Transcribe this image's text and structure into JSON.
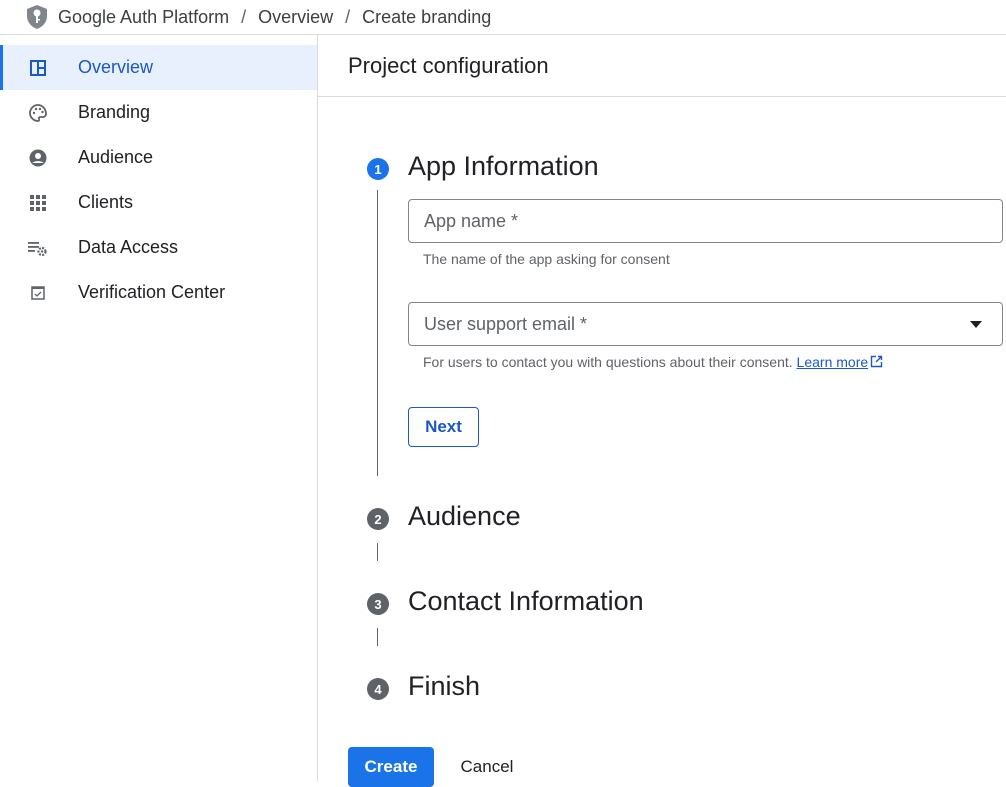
{
  "breadcrumb": [
    "Google Auth Platform",
    "Overview",
    "Create branding"
  ],
  "sidebar": {
    "items": [
      {
        "label": "Overview",
        "icon": "dashboard-icon",
        "active": true
      },
      {
        "label": "Branding",
        "icon": "palette-icon"
      },
      {
        "label": "Audience",
        "icon": "account-circle-icon"
      },
      {
        "label": "Clients",
        "icon": "apps-grid-icon"
      },
      {
        "label": "Data Access",
        "icon": "data-settings-icon"
      },
      {
        "label": "Verification Center",
        "icon": "checkbox-icon"
      }
    ]
  },
  "main": {
    "title": "Project configuration",
    "steps": [
      {
        "num": "1",
        "title": "App Information"
      },
      {
        "num": "2",
        "title": "Audience"
      },
      {
        "num": "3",
        "title": "Contact Information"
      },
      {
        "num": "4",
        "title": "Finish"
      }
    ],
    "app_name": {
      "placeholder": "App name *",
      "help": "The name of the app asking for consent"
    },
    "email": {
      "placeholder": "User support email *",
      "help": "For users to contact you with questions about their consent.",
      "learn_more": "Learn more"
    },
    "next_label": "Next",
    "create_label": "Create",
    "cancel_label": "Cancel"
  },
  "colors": {
    "accent": "#1a73e8",
    "active_bg": "#e8f0fe"
  }
}
